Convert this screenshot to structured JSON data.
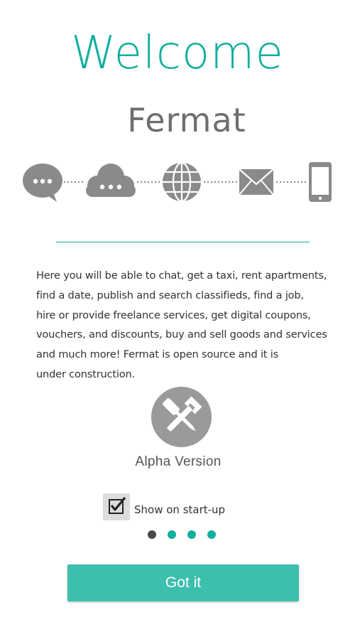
{
  "header": {
    "title": "Welcome",
    "app_name": "Fermat"
  },
  "feature_icons": [
    "chat-bubble-icon",
    "cloud-icon",
    "globe-icon",
    "envelope-icon",
    "smartphone-icon"
  ],
  "description": {
    "lines": [
      "Here you will  be able to chat, get a taxi, rent apartments,",
      "find a date, publish and search classifieds, find a job,",
      "hire or provide freelance services, get digital coupons,",
      "vouchers, and discounts, buy and sell goods and services",
      "and much more! Fermat is open source and it is",
      "under construction."
    ]
  },
  "version": {
    "icon": "tools-icon",
    "label": "Alpha Version"
  },
  "startup": {
    "checked": true,
    "label": "Show on start-up"
  },
  "pager": {
    "total": 4,
    "active_index": 0
  },
  "actions": {
    "got_it_label": "Got it"
  },
  "colors": {
    "accent": "#12aea0",
    "button": "#3dbfad",
    "icon_gray": "#8a8a8a",
    "dot_active": "#4a4a4a",
    "dot_inactive": "#12aea0"
  }
}
